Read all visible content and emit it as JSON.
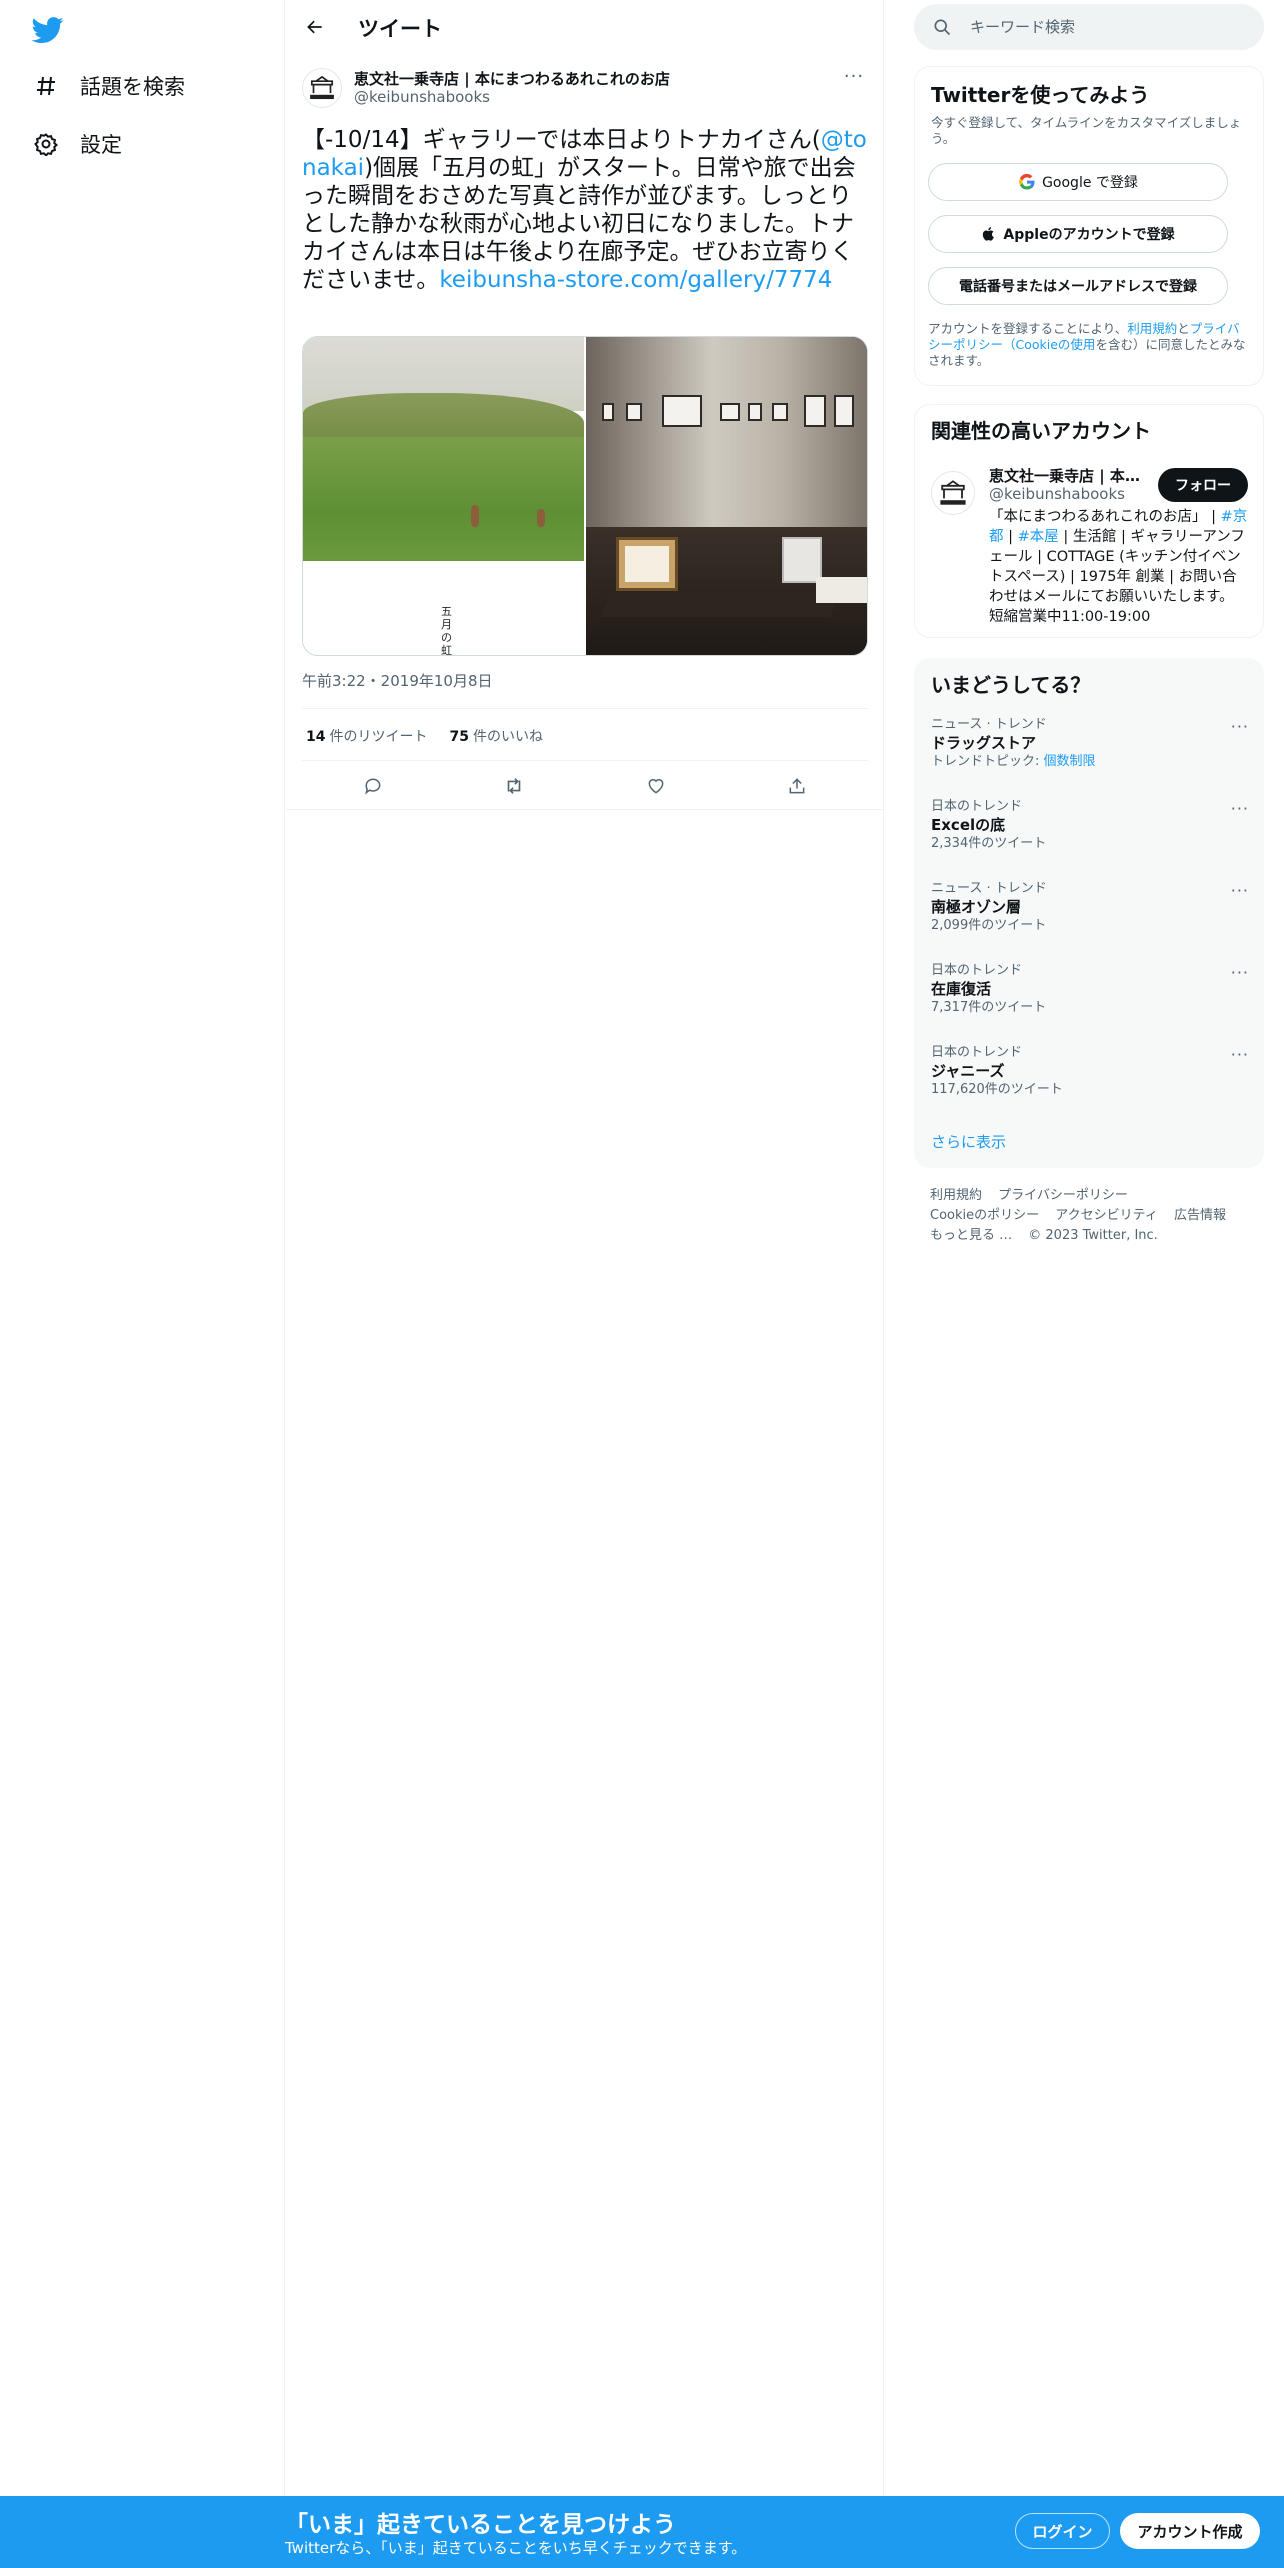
{
  "nav": {
    "logo_icon": "twitter-bird-icon",
    "items": [
      {
        "label": "話題を検索",
        "icon": "hashtag-icon"
      },
      {
        "label": "設定",
        "icon": "gear-icon"
      }
    ]
  },
  "header": {
    "title": "ツイート"
  },
  "tweet": {
    "author_name": "恵文社一乗寺店 | 本にまつわるあれこれのお店",
    "author_handle": "@keibunshabooks",
    "text_1": "【-10/14】ギャラリーでは本日よりトナカイさん(",
    "mention": "@tonakai",
    "text_2": ")個展「五月の虹」がスタート。日常や旅で出会った瞬間をおさめた写真と詩作が並びます。しっとりとした静かな秋雨が心地よい初日になりました。トナカイさんは本日は午後より在廊予定。ぜひお立寄りくださいませ。",
    "link": "keibunsha-store.com/gallery/7774",
    "photo_caption": "五月の虹",
    "timestamp": "午前3:22・2019年10月8日",
    "retweets_count": "14",
    "retweets_label": "件のリツイート",
    "likes_count": "75",
    "likes_label": "件のいいね"
  },
  "search": {
    "placeholder": "キーワード検索"
  },
  "signup_card": {
    "title": "Twitterを使ってみよう",
    "subtitle": "今すぐ登録して、タイムラインをカスタマイズしましょう。",
    "google_label": "Google で登録",
    "apple_label": "Appleのアカウントで登録",
    "phone_label": "電話番号またはメールアドレスで登録",
    "legal_1": "アカウントを登録することにより、",
    "legal_terms": "利用規約",
    "legal_2": "と",
    "legal_privacy": "プライバシーポリシー（Cookieの使用",
    "legal_3": "を含む）に同意したとみなされます。"
  },
  "recommended": {
    "title": "関連性の高いアカウント",
    "name": "恵文社一乗寺店 | 本にまつわるあれこれのお店",
    "handle": "@keibunshabooks",
    "follow_label": "フォロー",
    "bio_1": "「本にまつわるあれこれのお店」 | ",
    "bio_tag1": "#京都",
    "bio_2": " | ",
    "bio_tag2": "#本屋",
    "bio_3": " | 生活館 | ギャラリーアンフェール | COTTAGE (キッチン付イベントスペース) | 1975年 創業 | お問い合わせはメールにてお願いいたします。 短縮営業中11:00-19:00"
  },
  "trends": {
    "title": "いまどうしてる？",
    "items": [
      {
        "meta": "ニュース · トレンド",
        "name": "ドラッグストア",
        "count_prefix": "トレンドトピック: ",
        "count_link": "個数制限",
        "count": ""
      },
      {
        "meta": "日本のトレンド",
        "name": "Excelの底",
        "count_prefix": "",
        "count_link": "",
        "count": "2,334件のツイート"
      },
      {
        "meta": "ニュース · トレンド",
        "name": "南極オゾン層",
        "count_prefix": "",
        "count_link": "",
        "count": "2,099件のツイート"
      },
      {
        "meta": "日本のトレンド",
        "name": "在庫復活",
        "count_prefix": "",
        "count_link": "",
        "count": "7,317件のツイート"
      },
      {
        "meta": "日本のトレンド",
        "name": "ジャニーズ",
        "count_prefix": "",
        "count_link": "",
        "count": "117,620件のツイート"
      }
    ],
    "show_more": "さらに表示"
  },
  "footer": {
    "terms": "利用規約",
    "privacy": "プライバシーポリシー",
    "cookie": "Cookieのポリシー",
    "accessibility": "アクセシビリティ",
    "ads": "広告情報",
    "more": "もっと見る …",
    "copyright": "© 2023 Twitter, Inc."
  },
  "banner": {
    "title": "「いま」起きていることを見つけよう",
    "subtitle": "Twitterなら、「いま」起きていることをいち早くチェックできます。",
    "login_label": "ログイン",
    "signup_label": "アカウント作成"
  },
  "colors": {
    "accent": "#1d9bf0",
    "text": "#0f1419",
    "muted": "#536471"
  }
}
